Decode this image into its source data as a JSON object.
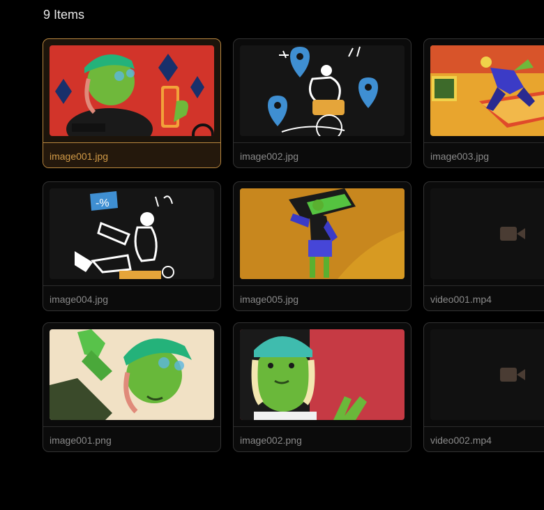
{
  "header": {
    "items_count": "9 Items"
  },
  "colors": {
    "background": "#000000",
    "selected_accent": "#d19a47",
    "card_border": "#333333"
  },
  "files": [
    {
      "name": "image001.jpg",
      "kind": "image",
      "selected": true
    },
    {
      "name": "image002.jpg",
      "kind": "image",
      "selected": false
    },
    {
      "name": "image003.jpg",
      "kind": "image",
      "selected": false
    },
    {
      "name": "image004.jpg",
      "kind": "image",
      "selected": false
    },
    {
      "name": "image005.jpg",
      "kind": "image",
      "selected": false
    },
    {
      "name": "video001.mp4",
      "kind": "video",
      "icon": "video-camera-icon",
      "selected": false
    },
    {
      "name": "image001.png",
      "kind": "image",
      "selected": false
    },
    {
      "name": "image002.png",
      "kind": "image",
      "selected": false
    },
    {
      "name": "video002.mp4",
      "kind": "video",
      "icon": "video-camera-icon",
      "selected": false
    }
  ]
}
